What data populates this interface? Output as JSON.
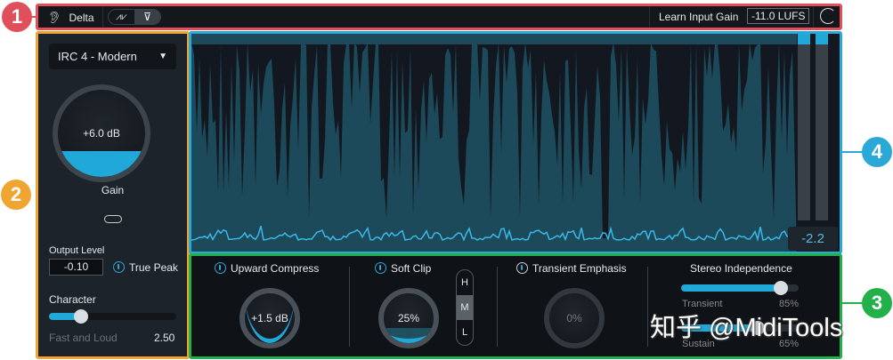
{
  "badges": {
    "one": "1",
    "two": "2",
    "three": "3",
    "four": "4"
  },
  "topbar": {
    "delta_label": "Delta",
    "learn_label": "Learn Input Gain",
    "lufs_value": "-11.0 LUFS"
  },
  "left": {
    "mode": "IRC 4 - Modern",
    "gain_value": "+6.0 dB",
    "gain_label": "Gain",
    "gain_fraction": 0.3,
    "output_label": "Output Level",
    "output_value": "-0.10",
    "true_peak": "True Peak",
    "character_label": "Character",
    "character_mode": "Fast and Loud",
    "character_value": "2.50",
    "character_fraction": 0.25
  },
  "meter": {
    "readout": "-2.2"
  },
  "bottom": {
    "upward": {
      "label": "Upward Compress",
      "value": "+1.5 dB"
    },
    "softclip": {
      "label": "Soft Clip",
      "value": "25%",
      "hml": [
        "H",
        "M",
        "L"
      ],
      "selected": "M"
    },
    "transient": {
      "label": "Transient Emphasis",
      "value": "0%"
    },
    "stereo": {
      "label": "Stereo Independence",
      "transient_label": "Transient",
      "transient_value": "85%",
      "transient_fraction": 0.85,
      "sustain_label": "Sustain",
      "sustain_value": "65%",
      "sustain_fraction": 0.65
    }
  },
  "watermark": "知乎 @MidiTools",
  "colors": {
    "accent": "#1fa8d8",
    "red": "#e0505a",
    "orange": "#f0a530",
    "cyan": "#2aa8d8",
    "green": "#22b04a"
  }
}
